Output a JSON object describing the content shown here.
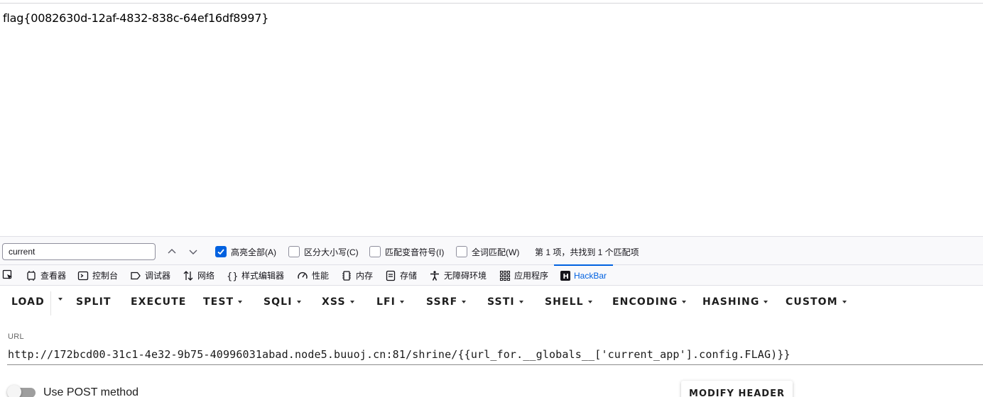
{
  "page": {
    "flag_text": "flag{0082630d-12af-4832-838c-64ef16df8997}"
  },
  "findbar": {
    "query": "current",
    "options": [
      {
        "label": "高亮全部(A)",
        "checked": true
      },
      {
        "label": "区分大小写(C)",
        "checked": false
      },
      {
        "label": "匹配变音符号(I)",
        "checked": false
      },
      {
        "label": "全词匹配(W)",
        "checked": false
      }
    ],
    "status": "第 1 项，共找到 1 个匹配项"
  },
  "devtools": {
    "tabs": [
      {
        "label": "查看器",
        "icon": "inspector-icon"
      },
      {
        "label": "控制台",
        "icon": "console-icon"
      },
      {
        "label": "调试器",
        "icon": "debugger-icon"
      },
      {
        "label": "网络",
        "icon": "network-icon"
      },
      {
        "label": "样式编辑器",
        "icon": "style-editor-icon"
      },
      {
        "label": "性能",
        "icon": "performance-icon"
      },
      {
        "label": "内存",
        "icon": "memory-icon"
      },
      {
        "label": "存储",
        "icon": "storage-icon"
      },
      {
        "label": "无障碍环境",
        "icon": "accessibility-icon"
      },
      {
        "label": "应用程序",
        "icon": "application-icon"
      },
      {
        "label": "HackBar",
        "icon": "hackbar-icon",
        "active": true
      }
    ],
    "accent": "#0061e0"
  },
  "hackbar": {
    "buttons": [
      {
        "label": "LOAD",
        "dropdown": false
      },
      {
        "label": "SPLIT",
        "dropdown": false
      },
      {
        "label": "EXECUTE",
        "dropdown": false
      },
      {
        "label": "TEST",
        "dropdown": true
      },
      {
        "label": "SQLI",
        "dropdown": true
      },
      {
        "label": "XSS",
        "dropdown": true
      },
      {
        "label": "LFI",
        "dropdown": true
      },
      {
        "label": "SSRF",
        "dropdown": true
      },
      {
        "label": "SSTI",
        "dropdown": true
      },
      {
        "label": "SHELL",
        "dropdown": true
      },
      {
        "label": "ENCODING",
        "dropdown": true
      },
      {
        "label": "HASHING",
        "dropdown": true
      },
      {
        "label": "CUSTOM",
        "dropdown": true
      }
    ],
    "url_label": "URL",
    "url_value": "http://172bcd00-31c1-4e32-9b75-40996031abad.node5.buuoj.cn:81/shrine/{{url_for.__globals__['current_app'].config.FLAG)}}",
    "post_toggle_label": "Use POST method",
    "post_enabled": false,
    "modify_header_label": "MODIFY HEADER"
  }
}
